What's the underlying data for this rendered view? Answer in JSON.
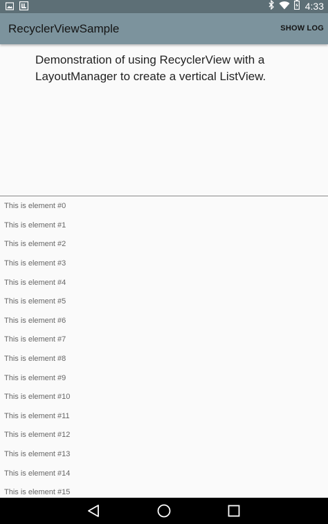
{
  "status_bar": {
    "time": "4:33",
    "left_icons": [
      "gallery-icon",
      "launcher-icon"
    ],
    "right_icons": [
      "bluetooth-icon",
      "wifi-icon",
      "battery-icon"
    ]
  },
  "app_bar": {
    "title": "RecyclerViewSample",
    "action_label": "SHOW LOG"
  },
  "intro": {
    "text": "Demonstration of using RecyclerView with a LayoutManager to create a vertical ListView."
  },
  "list": {
    "items": [
      "This is element #0",
      "This is element #1",
      "This is element #2",
      "This is element #3",
      "This is element #4",
      "This is element #5",
      "This is element #6",
      "This is element #7",
      "This is element #8",
      "This is element #9",
      "This is element #10",
      "This is element #11",
      "This is element #12",
      "This is element #13",
      "This is element #14",
      "This is element #15"
    ]
  },
  "nav_bar": {
    "buttons": [
      "back-icon",
      "home-icon",
      "recent-apps-icon"
    ]
  },
  "colors": {
    "status_bar": "#5d6f76",
    "app_bar": "#7c939d",
    "background": "#fafafa",
    "nav_bar": "#000000"
  }
}
